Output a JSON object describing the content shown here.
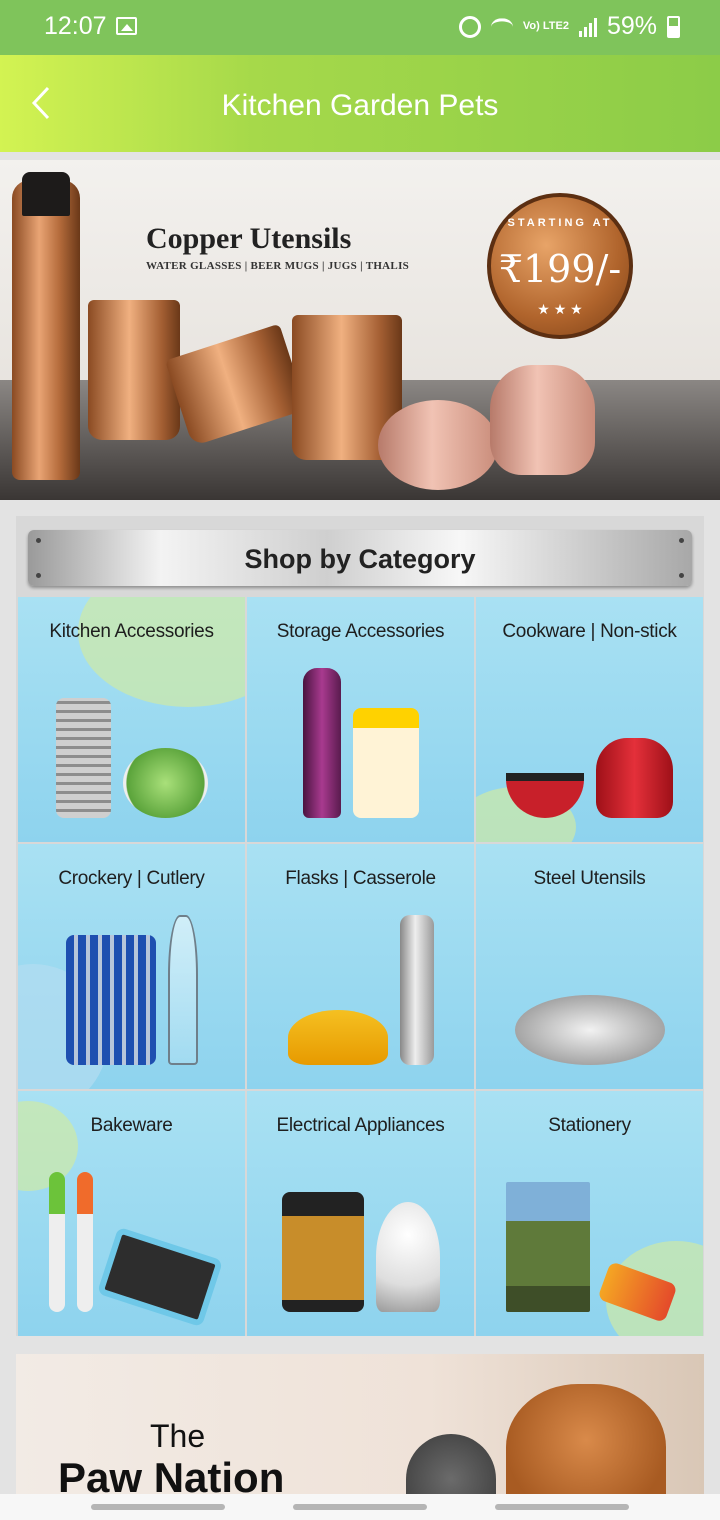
{
  "status_bar": {
    "time": "12:07",
    "network": "Vo) LTE2",
    "battery": "59%",
    "icons": [
      "image-icon",
      "alarm-icon",
      "wifi-icon",
      "signal-icon",
      "battery-icon"
    ]
  },
  "app_bar": {
    "title": "Kitchen Garden Pets",
    "back_icon": "chevron-left-icon"
  },
  "banner": {
    "title": "Copper Utensils",
    "subtitle": "WATER GLASSES | BEER MUGS | JUGS | THALIS",
    "badge_top": "STARTING AT",
    "price": "₹199/-",
    "badge_stars": "★ ★ ★",
    "slide_count": 6,
    "active_slide": 6
  },
  "category_section": {
    "title": "Shop by Category",
    "items": [
      {
        "label": "Kitchen Accessories"
      },
      {
        "label": "Storage Accessories"
      },
      {
        "label": "Cookware | Non-stick"
      },
      {
        "label": "Crockery | Cutlery"
      },
      {
        "label": "Flasks | Casserole"
      },
      {
        "label": "Steel Utensils"
      },
      {
        "label": "Bakeware"
      },
      {
        "label": "Electrical Appliances"
      },
      {
        "label": "Stationery"
      }
    ]
  },
  "promo_banner": {
    "line1": "The",
    "line2": "Paw Nation"
  },
  "colors": {
    "status_bar": "#7fc45b",
    "app_bar_start": "#d3f352",
    "app_bar_end": "#8ccc48",
    "tile_background": "#a9e1f3",
    "active_dot": "#f0c200"
  }
}
